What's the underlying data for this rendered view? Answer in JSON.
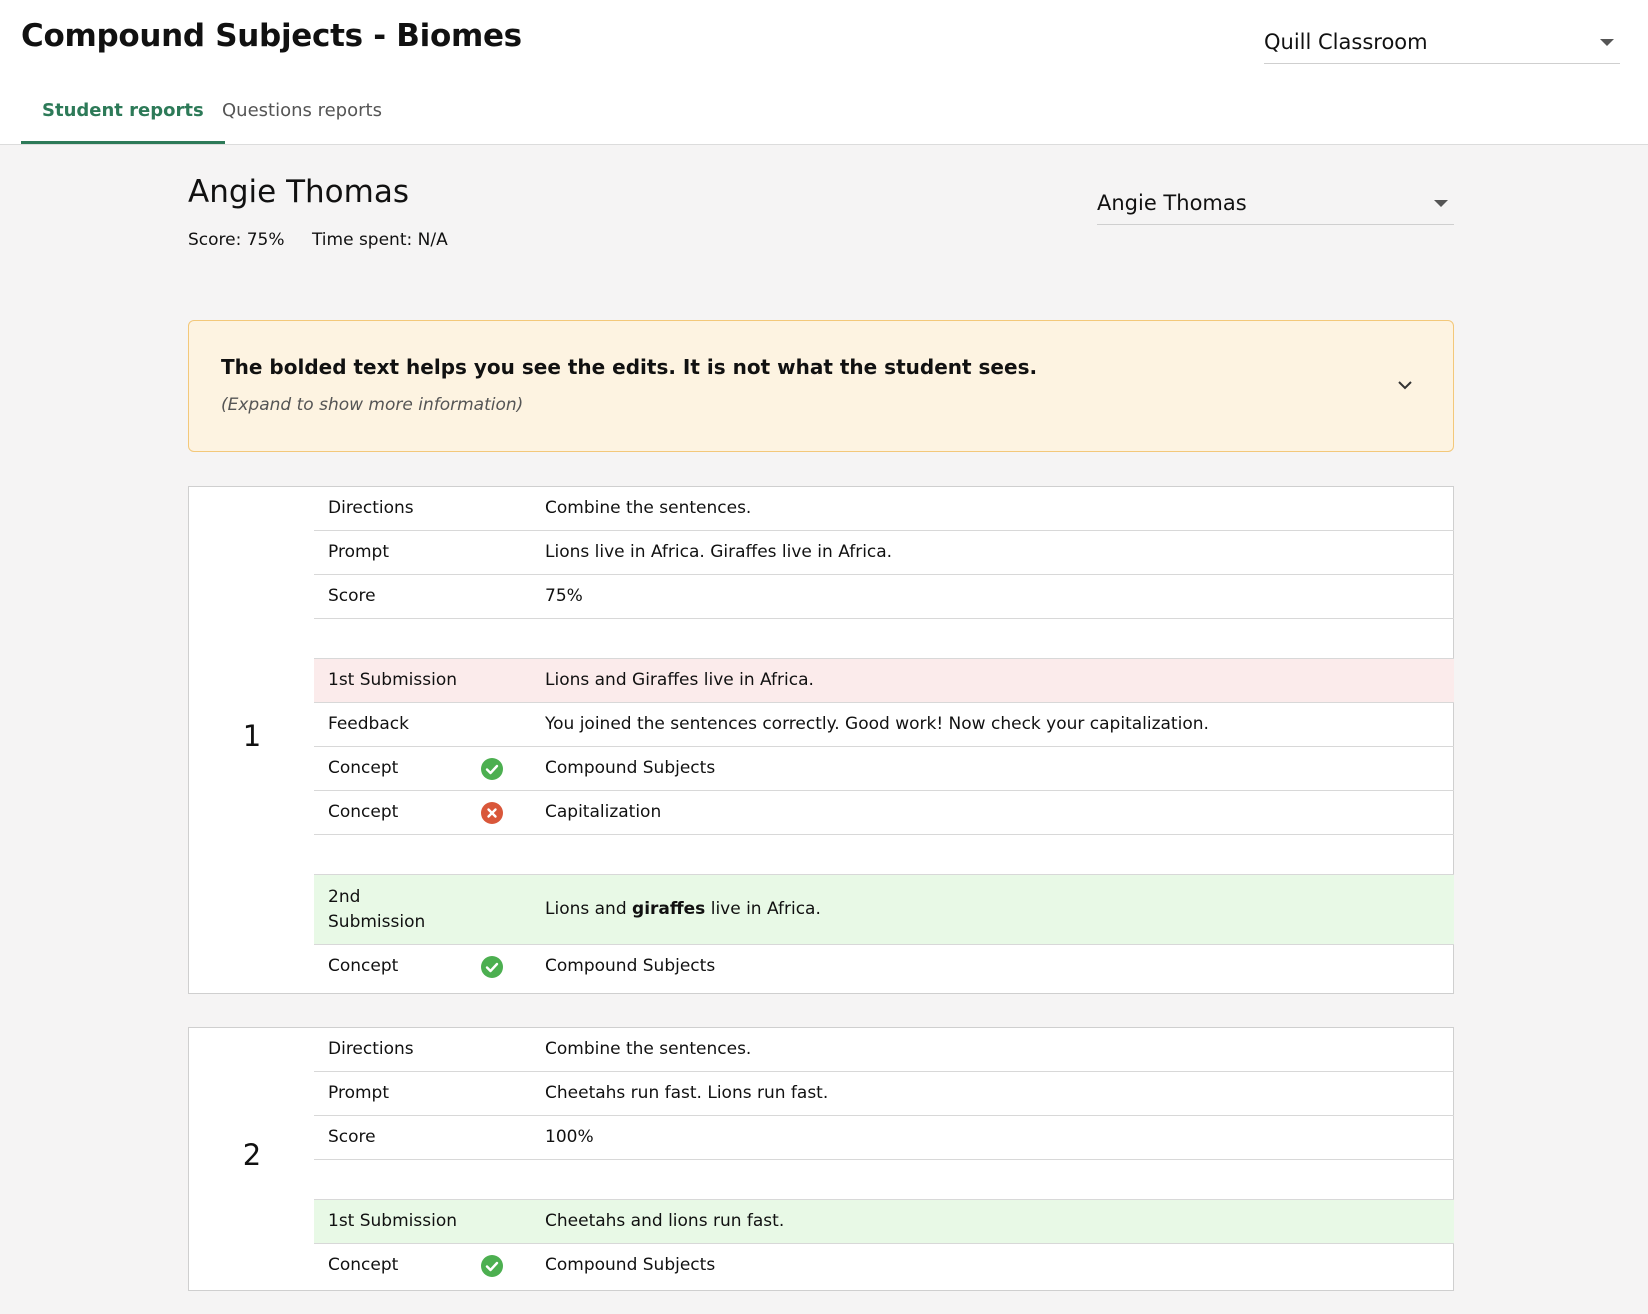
{
  "header": {
    "title": "Compound Subjects - Biomes",
    "classroom_select": "Quill Classroom",
    "tabs": [
      {
        "label": "Student reports",
        "active": true
      },
      {
        "label": "Questions reports",
        "active": false
      }
    ]
  },
  "student": {
    "name": "Angie Thomas",
    "score": "Score: 75%",
    "time_spent": "Time spent: N/A",
    "select_value": "Angie Thomas"
  },
  "notice": {
    "title": "The bolded text helps you see the edits. It is not what the student sees.",
    "subtitle": "(Expand to show more information)",
    "icon": "chevron-down-icon"
  },
  "colors": {
    "accent": "#2d7a58",
    "correct": "#4caf50",
    "incorrect": "#d9573a",
    "submission_incorrect_bg": "#fbebeb",
    "submission_correct_bg": "#e8f9e6",
    "notice_bg": "#fdf3e1",
    "notice_border": "#f3c87a"
  },
  "questions": [
    {
      "number": "1",
      "directions_label": "Directions",
      "directions": "Combine the sentences.",
      "prompt_label": "Prompt",
      "prompt": "Lions live in Africa. Giraffes live in Africa.",
      "score_label": "Score",
      "score": "75%",
      "submissions": [
        {
          "label": "1st Submission",
          "text": "Lions and Giraffes live in Africa.",
          "status": "incorrect",
          "feedback_label": "Feedback",
          "feedback": "You joined the sentences correctly. Good work! Now check your capitalization.",
          "concepts": [
            {
              "label": "Concept",
              "name": "Compound Subjects",
              "result": "correct",
              "icon": "check-circle-icon"
            },
            {
              "label": "Concept",
              "name": "Capitalization",
              "result": "incorrect",
              "icon": "x-circle-icon"
            }
          ]
        },
        {
          "label_line1": "2nd",
          "label_line2": "Submission",
          "text_before": "Lions and ",
          "text_bold": "giraffes",
          "text_after": " live in Africa.",
          "status": "correct",
          "concepts": [
            {
              "label": "Concept",
              "name": "Compound Subjects",
              "result": "correct",
              "icon": "check-circle-icon"
            }
          ]
        }
      ]
    },
    {
      "number": "2",
      "directions_label": "Directions",
      "directions": "Combine the sentences.",
      "prompt_label": "Prompt",
      "prompt": "Cheetahs run fast. Lions run fast.",
      "score_label": "Score",
      "score": "100%",
      "submissions": [
        {
          "label": "1st Submission",
          "text": "Cheetahs and lions run fast.",
          "status": "correct",
          "concepts": [
            {
              "label": "Concept",
              "name": "Compound Subjects",
              "result": "correct",
              "icon": "check-circle-icon"
            }
          ]
        }
      ]
    }
  ]
}
